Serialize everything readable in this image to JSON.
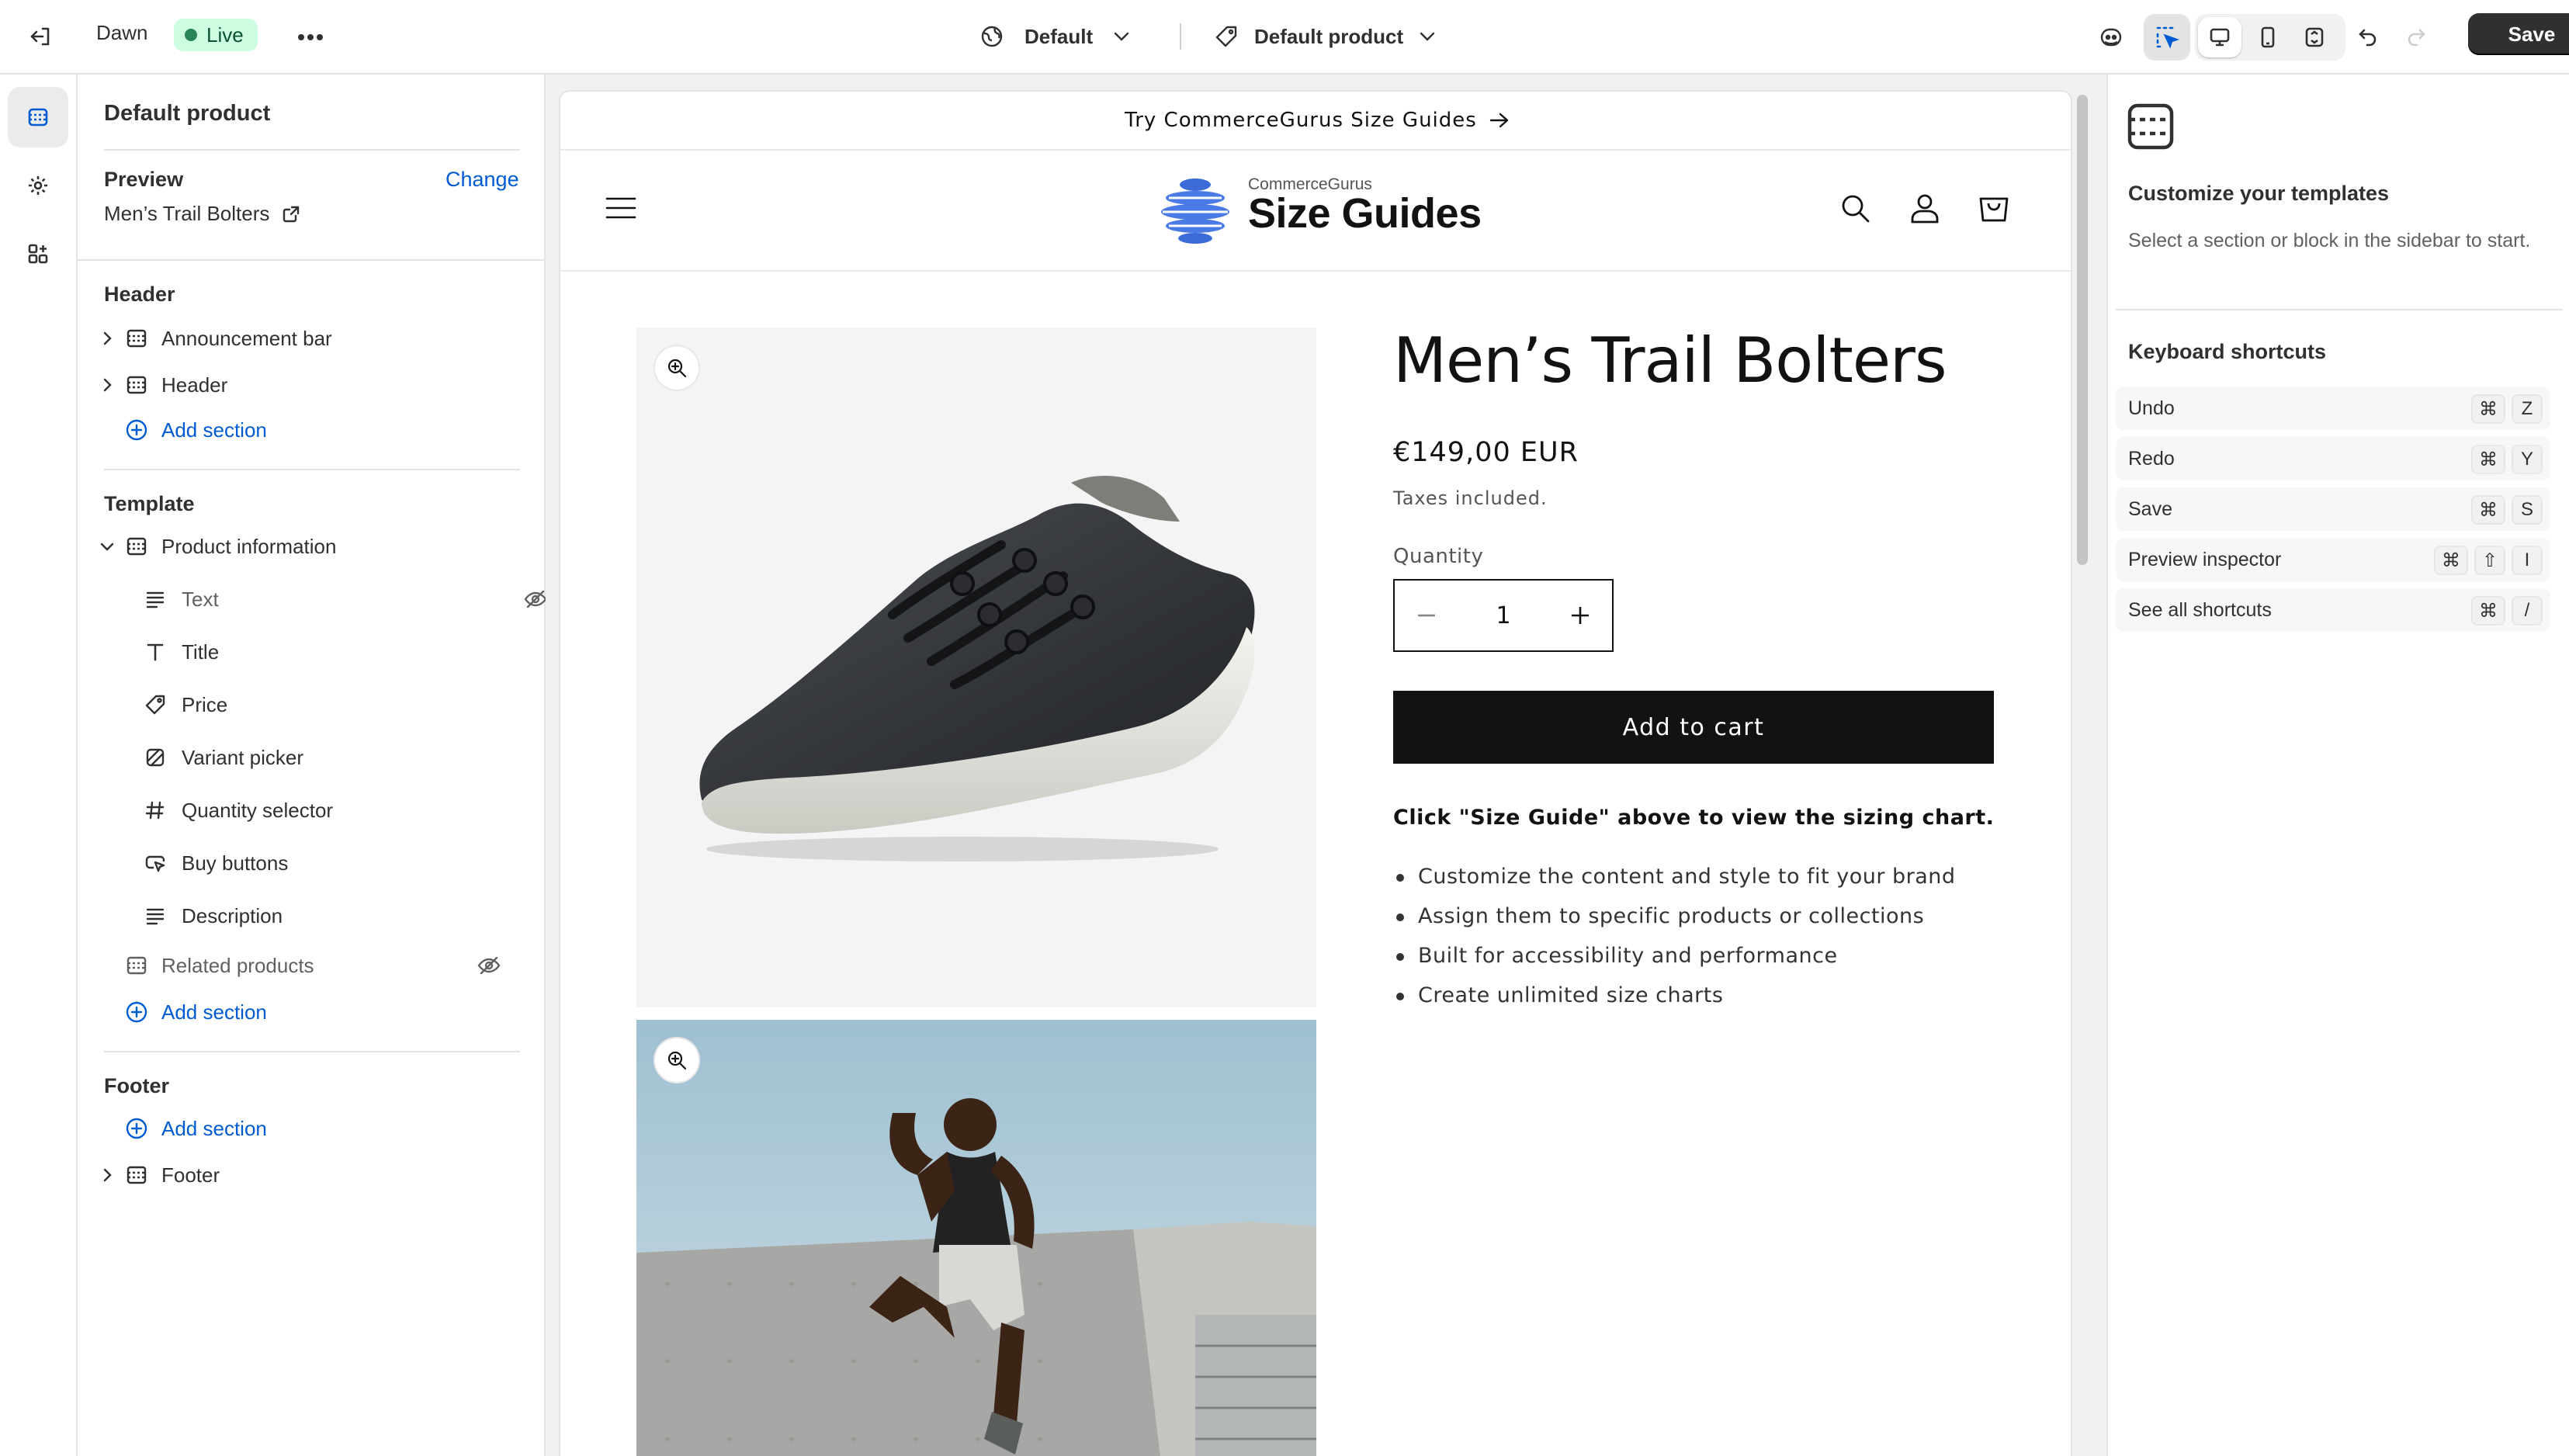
{
  "topbar": {
    "theme_name": "Dawn",
    "live_label": "Live",
    "theme_select": "Default",
    "template_select": "Default product",
    "save_label": "Save"
  },
  "sidebar": {
    "title": "Default product",
    "preview": {
      "label": "Preview",
      "change_label": "Change",
      "product": "Men’s Trail Bolters"
    },
    "header_group": {
      "heading": "Header",
      "items": [
        {
          "label": "Announcement bar",
          "icon": "section-icon"
        },
        {
          "label": "Header",
          "icon": "section-icon"
        }
      ],
      "add_label": "Add section"
    },
    "template_group": {
      "heading": "Template",
      "section": "Product information",
      "blocks": [
        {
          "label": "Text",
          "icon": "text-icon",
          "hidden": true
        },
        {
          "label": "Title",
          "icon": "title-icon"
        },
        {
          "label": "Price",
          "icon": "price-tag-icon"
        },
        {
          "label": "Variant picker",
          "icon": "variant-icon"
        },
        {
          "label": "Quantity selector",
          "icon": "hash-icon"
        },
        {
          "label": "Buy buttons",
          "icon": "cursor-button-icon"
        },
        {
          "label": "Description",
          "icon": "text-icon"
        }
      ],
      "related": {
        "label": "Related products",
        "hidden": true
      },
      "add_label": "Add section"
    },
    "footer_group": {
      "heading": "Footer",
      "add_label": "Add section",
      "items": [
        {
          "label": "Footer",
          "icon": "section-icon"
        }
      ]
    }
  },
  "preview": {
    "announcement": "Try CommerceGurus Size Guides",
    "logo_small": "CommerceGurus",
    "logo_big": "Size Guides",
    "product": {
      "title": "Men’s Trail Bolters",
      "price": "€149,00 EUR",
      "tax_note": "Taxes included.",
      "quantity_label": "Quantity",
      "quantity_value": "1",
      "add_to_cart": "Add to cart",
      "description_heading": "Click \"Size Guide\" above to view the sizing chart.",
      "bullets": [
        "Customize the content and style to fit your brand",
        "Assign them to specific products or collections",
        "Built for accessibility and performance",
        "Create unlimited size charts"
      ]
    }
  },
  "right_panel": {
    "title": "Customize your templates",
    "text": "Select a section or block in the sidebar to start.",
    "shortcuts_title": "Keyboard shortcuts",
    "shortcuts": [
      {
        "label": "Undo",
        "keys": [
          "⌘",
          "Z"
        ]
      },
      {
        "label": "Redo",
        "keys": [
          "⌘",
          "Y"
        ]
      },
      {
        "label": "Save",
        "keys": [
          "⌘",
          "S"
        ]
      },
      {
        "label": "Preview inspector",
        "keys": [
          "⌘",
          "⇧",
          "I"
        ]
      },
      {
        "label": "See all shortcuts",
        "keys": [
          "⌘",
          "/"
        ]
      }
    ]
  },
  "colors": {
    "accent": "#005bd3",
    "live_bg": "#cdfee1",
    "live_dot": "#29845a",
    "button_dark": "#303030",
    "store_black": "#121212"
  }
}
